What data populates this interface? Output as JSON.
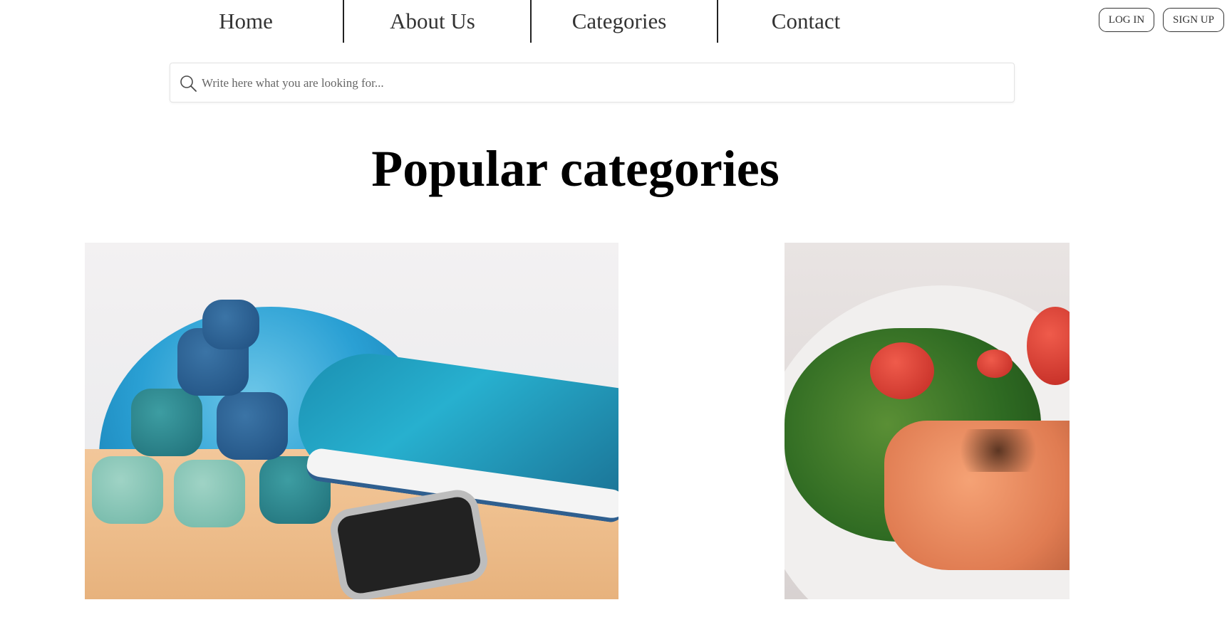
{
  "nav": {
    "items": [
      {
        "label": "Home"
      },
      {
        "label": "About Us"
      },
      {
        "label": "Categories"
      },
      {
        "label": "Contact"
      }
    ]
  },
  "auth": {
    "login_label": "LOG IN",
    "signup_label": "SIGN UP"
  },
  "search": {
    "placeholder": "Write here what you are looking for..."
  },
  "main": {
    "heading": "Popular categories",
    "categories": [
      {
        "image_description": "dumbbells and running shoe"
      },
      {
        "image_description": "grilled salmon with salad"
      }
    ]
  },
  "icons": {
    "search": "search-icon"
  },
  "colors": {
    "text": "#333333",
    "border": "#e3e3e3",
    "background": "#ffffff"
  }
}
